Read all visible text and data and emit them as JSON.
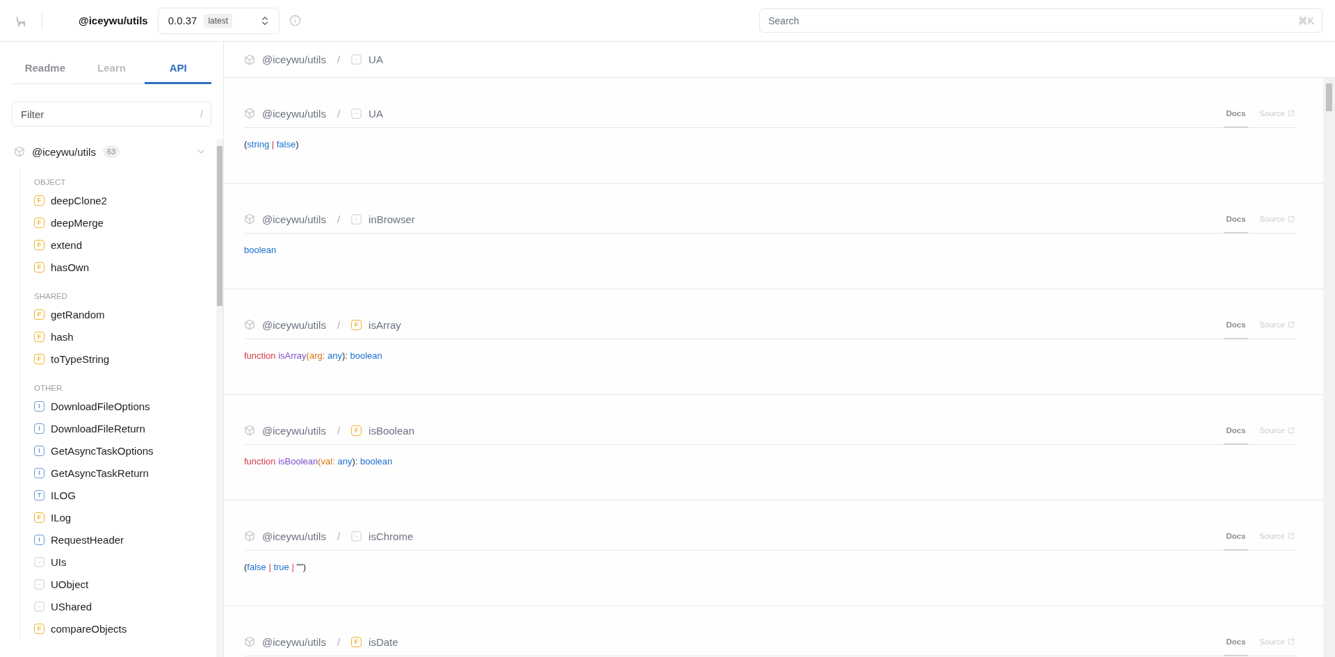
{
  "header": {
    "package": "@iceywu/utils",
    "version": "0.0.37",
    "version_tag": "latest",
    "search": {
      "placeholder": "Search",
      "shortcut": "⌘K"
    }
  },
  "sidebar": {
    "tabs": [
      {
        "label": "Readme",
        "selected": false,
        "disabled": false
      },
      {
        "label": "Learn",
        "selected": false,
        "disabled": true
      },
      {
        "label": "API",
        "selected": true,
        "disabled": false
      }
    ],
    "filter": {
      "placeholder": "Filter",
      "shortcut": "/"
    },
    "tree": {
      "name": "@iceywu/utils",
      "count": "63",
      "expanded": true,
      "groups": [
        {
          "title": "OBJECT",
          "items": [
            {
              "name": "deepClone2",
              "kind": "function",
              "badge": "F"
            },
            {
              "name": "deepMerge",
              "kind": "function",
              "badge": "F"
            },
            {
              "name": "extend",
              "kind": "function",
              "badge": "F"
            },
            {
              "name": "hasOwn",
              "kind": "function",
              "badge": "F"
            }
          ]
        },
        {
          "title": "SHARED",
          "items": [
            {
              "name": "getRandom",
              "kind": "function",
              "badge": "F"
            },
            {
              "name": "hash",
              "kind": "function",
              "badge": "F"
            },
            {
              "name": "toTypeString",
              "kind": "function",
              "badge": "F"
            }
          ]
        },
        {
          "title": "OTHER",
          "items": [
            {
              "name": "DownloadFileOptions",
              "kind": "interface",
              "badge": "I"
            },
            {
              "name": "DownloadFileReturn",
              "kind": "interface",
              "badge": "I"
            },
            {
              "name": "GetAsyncTaskOptions",
              "kind": "interface",
              "badge": "I"
            },
            {
              "name": "GetAsyncTaskReturn",
              "kind": "interface",
              "badge": "I"
            },
            {
              "name": "ILOG",
              "kind": "type",
              "badge": "T"
            },
            {
              "name": "ILog",
              "kind": "function",
              "badge": "F"
            },
            {
              "name": "RequestHeader",
              "kind": "interface",
              "badge": "I"
            },
            {
              "name": "UIs",
              "kind": "variable"
            },
            {
              "name": "UObject",
              "kind": "variable"
            },
            {
              "name": "UShared",
              "kind": "variable"
            },
            {
              "name": "compareObjects",
              "kind": "function",
              "badge": "F"
            }
          ]
        }
      ]
    }
  },
  "breadcrumb": {
    "package": "@iceywu/utils",
    "separator": "/",
    "symbol": "UA",
    "kind": "variable"
  },
  "entries": [
    {
      "package": "@iceywu/utils",
      "symbol": "UA",
      "kind": "variable",
      "links": [
        {
          "label": "Docs",
          "selected": true
        },
        {
          "label": "Source",
          "selected": false
        }
      ],
      "signature": [
        {
          "text": "(",
          "kind": "punct"
        },
        {
          "text": "string",
          "kind": "type"
        },
        {
          "text": " | ",
          "kind": "op"
        },
        {
          "text": "false",
          "kind": "type"
        },
        {
          "text": ")",
          "kind": "punct"
        }
      ]
    },
    {
      "package": "@iceywu/utils",
      "symbol": "inBrowser",
      "kind": "variable",
      "links": [
        {
          "label": "Docs",
          "selected": true
        },
        {
          "label": "Source",
          "selected": false
        }
      ],
      "signature": [
        {
          "text": "boolean",
          "kind": "type"
        }
      ]
    },
    {
      "package": "@iceywu/utils",
      "symbol": "isArray",
      "kind": "function",
      "badge": "F",
      "links": [
        {
          "label": "Docs",
          "selected": true
        },
        {
          "label": "Source",
          "selected": false
        }
      ],
      "signature": [
        {
          "text": "function ",
          "kind": "keyword"
        },
        {
          "text": "isArray",
          "kind": "name"
        },
        {
          "text": "(",
          "kind": "param"
        },
        {
          "text": "arg: ",
          "kind": "param"
        },
        {
          "text": "any",
          "kind": "type"
        },
        {
          "text": "): ",
          "kind": "punct"
        },
        {
          "text": "boolean",
          "kind": "type"
        }
      ]
    },
    {
      "package": "@iceywu/utils",
      "symbol": "isBoolean",
      "kind": "function",
      "badge": "F",
      "links": [
        {
          "label": "Docs",
          "selected": true
        },
        {
          "label": "Source",
          "selected": false
        }
      ],
      "signature": [
        {
          "text": "function ",
          "kind": "keyword"
        },
        {
          "text": "isBoolean",
          "kind": "name"
        },
        {
          "text": "(",
          "kind": "param"
        },
        {
          "text": "val: ",
          "kind": "param"
        },
        {
          "text": "any",
          "kind": "type"
        },
        {
          "text": "): ",
          "kind": "punct"
        },
        {
          "text": "boolean",
          "kind": "type"
        }
      ]
    },
    {
      "package": "@iceywu/utils",
      "symbol": "isChrome",
      "kind": "variable",
      "links": [
        {
          "label": "Docs",
          "selected": true
        },
        {
          "label": "Source",
          "selected": false
        }
      ],
      "signature": [
        {
          "text": "(",
          "kind": "punct"
        },
        {
          "text": "false",
          "kind": "type"
        },
        {
          "text": " | ",
          "kind": "op"
        },
        {
          "text": "true",
          "kind": "type"
        },
        {
          "text": " | ",
          "kind": "op"
        },
        {
          "text": "\"\"",
          "kind": "punct"
        },
        {
          "text": ")",
          "kind": "punct"
        }
      ]
    },
    {
      "package": "@iceywu/utils",
      "symbol": "isDate",
      "kind": "function",
      "badge": "F",
      "links": [
        {
          "label": "Docs",
          "selected": true
        },
        {
          "label": "Source",
          "selected": false
        }
      ]
    }
  ]
}
